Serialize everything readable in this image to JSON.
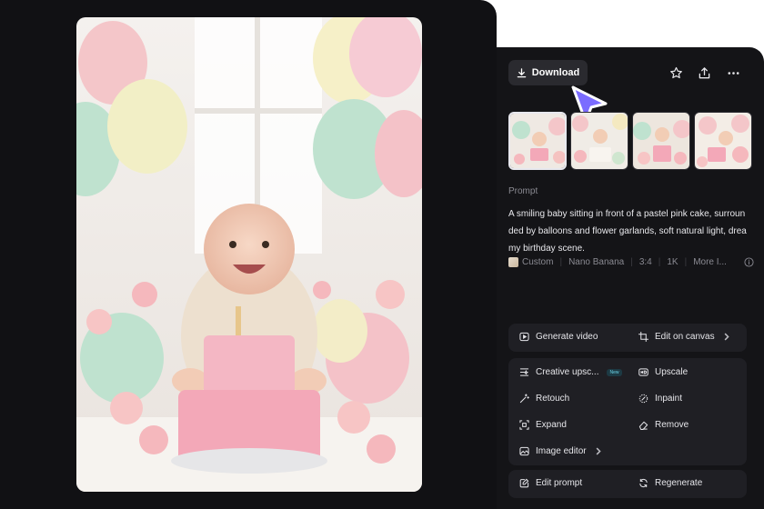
{
  "toolbar": {
    "download_label": "Download",
    "favorite_icon": "star-icon",
    "share_icon": "share-icon",
    "more_icon": "more-icon"
  },
  "main_image": {
    "description_icon": "photo"
  },
  "thumbnails": [
    {
      "name": "thumb-1",
      "active": true
    },
    {
      "name": "thumb-2",
      "active": false
    },
    {
      "name": "thumb-3",
      "active": false
    },
    {
      "name": "thumb-4",
      "active": false
    }
  ],
  "prompt": {
    "label": "Prompt",
    "text": "A smiling baby sitting in front of a pastel pink cake, surrounded by balloons and flower garlands, soft natural light, dreamy birthday scene."
  },
  "meta": {
    "style": "Custom",
    "model": "Nano Banana",
    "ratio": "3:4",
    "resolution": "1K",
    "more": "More I..."
  },
  "actions": {
    "generate_video": "Generate video",
    "edit_on_canvas": "Edit on canvas",
    "creative_upscale": "Creative upsc...",
    "new_badge": "New",
    "upscale": "Upscale",
    "retouch": "Retouch",
    "inpaint": "Inpaint",
    "expand": "Expand",
    "remove": "Remove",
    "image_editor": "Image editor",
    "edit_prompt": "Edit prompt",
    "regenerate": "Regenerate"
  },
  "colors": {
    "panel_bg": "#141417",
    "card_bg": "#1f1f24",
    "accent_cursor": "#7b6cff"
  }
}
